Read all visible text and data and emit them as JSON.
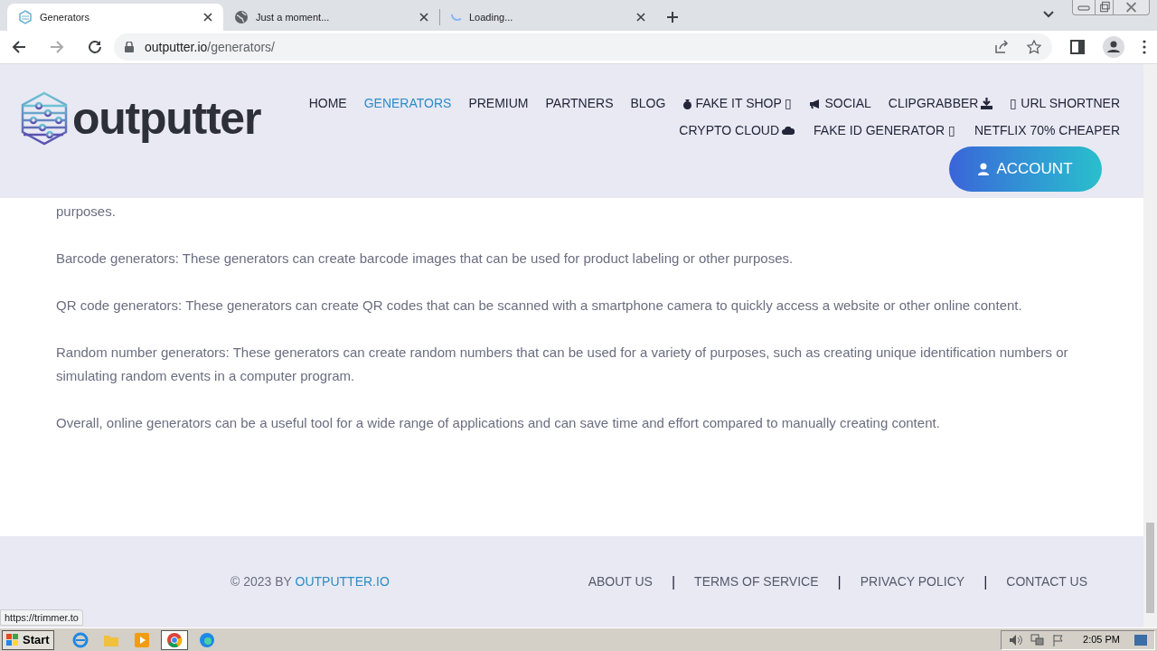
{
  "browser": {
    "tabs": [
      {
        "title": "Generators",
        "selected": true,
        "kind": "site"
      },
      {
        "title": "Just a moment...",
        "selected": false,
        "kind": "globe"
      },
      {
        "title": "Loading...",
        "selected": false,
        "kind": "loading"
      }
    ],
    "url_host": "outputter.io",
    "url_path": "/generators/"
  },
  "site": {
    "logo": "outputter",
    "nav": [
      {
        "label": "HOME",
        "selected": false
      },
      {
        "label": "GENERATORS",
        "selected": true
      },
      {
        "label": "PREMIUM",
        "selected": false
      },
      {
        "label": "PARTNERS",
        "selected": false
      },
      {
        "label": "BLOG",
        "selected": false
      },
      {
        "label": "FAKE IT SHOP ▯",
        "selected": false
      },
      {
        "label": "SOCIAL",
        "selected": false
      },
      {
        "label": "CLIPGRABBER",
        "selected": false
      },
      {
        "label": "▯ URL SHORTNER",
        "selected": false
      }
    ],
    "nav_row2": [
      {
        "label": "CRYPTO CLOUD",
        "selected": false
      },
      {
        "label": "FAKE ID GENERATOR ▯",
        "selected": false
      },
      {
        "label": "NETFLIX 70% CHEAPER",
        "selected": false
      }
    ],
    "account_button": "ACCOUNT"
  },
  "content": {
    "paragraphs": [
      "purposes.",
      "Barcode generators: These generators can create barcode images that can be used for product labeling or other purposes.",
      "QR code generators: These generators can create QR codes that can be scanned with a smartphone camera to quickly access a website or other online content.",
      "Random number generators: These generators can create random numbers that can be used for a variety of purposes, such as creating unique identification numbers or simulating random events in a computer program.",
      "Overall, online generators can be a useful tool for a wide range of applications and can save time and effort compared to manually creating content."
    ]
  },
  "footer": {
    "copyright": "© 2023 BY",
    "brand_link": "OUTPUTTER.IO",
    "links": [
      "ABOUT US",
      "TERMS OF SERVICE",
      "PRIVACY POLICY",
      "CONTACT US"
    ],
    "separator": "|"
  },
  "status_url": "https://trimmer.to",
  "taskbar": {
    "start": "Start",
    "clock": "2:05 PM"
  }
}
